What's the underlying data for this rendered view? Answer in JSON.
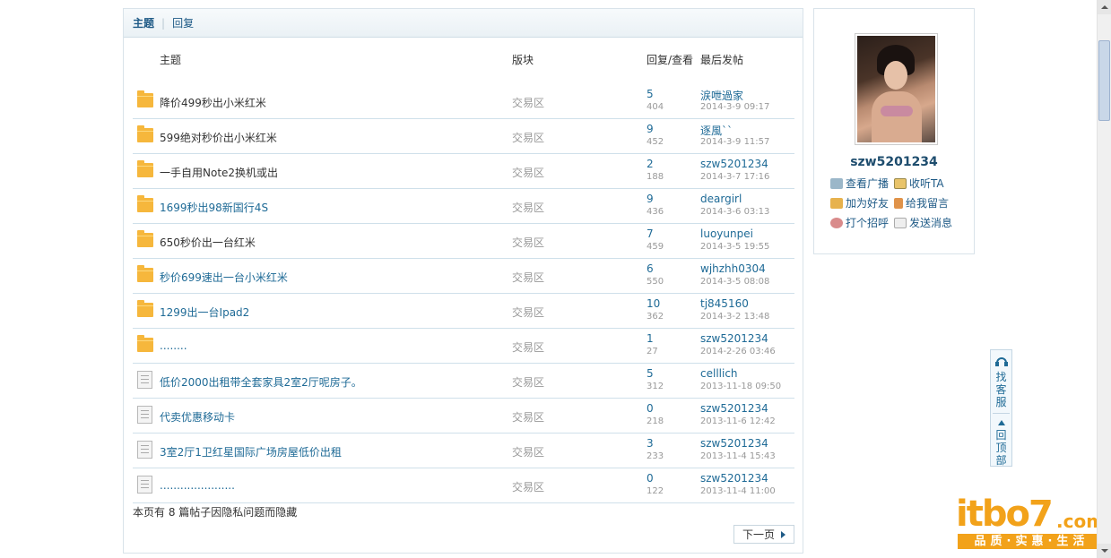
{
  "tabs": {
    "topics": "主题",
    "replies": "回复"
  },
  "table_header": {
    "topic": "主题",
    "forum": "版块",
    "reply_view": "回复/查看",
    "last_post": "最后发帖"
  },
  "rows": [
    {
      "icon": "folder-icon",
      "title": "降价499秒出小米红米",
      "forum": "交易区",
      "replies": "5",
      "views": "404",
      "last_user": "涙呭過家",
      "last_time": "2014-3-9 09:17"
    },
    {
      "icon": "folder-icon",
      "title": "599绝对秒价出小米红米",
      "forum": "交易区",
      "replies": "9",
      "views": "452",
      "last_user": "逐風``",
      "last_time": "2014-3-9 11:57"
    },
    {
      "icon": "folder-icon",
      "title": "一手自用Note2换机或出",
      "forum": "交易区",
      "replies": "2",
      "views": "188",
      "last_user": "szw5201234",
      "last_time": "2014-3-7 17:16"
    },
    {
      "icon": "folder-icon",
      "title": "1699秒出98新国行4S",
      "forum": "交易区",
      "replies": "9",
      "views": "436",
      "last_user": "deargirl",
      "last_time": "2014-3-6 03:13"
    },
    {
      "icon": "folder-icon",
      "title": "650秒价出一台红米",
      "forum": "交易区",
      "replies": "7",
      "views": "459",
      "last_user": "luoyunpei",
      "last_time": "2014-3-5 19:55"
    },
    {
      "icon": "folder-icon",
      "title": "秒价699速出一台小米红米",
      "forum": "交易区",
      "replies": "6",
      "views": "550",
      "last_user": "wjhzhh0304",
      "last_time": "2014-3-5 08:08"
    },
    {
      "icon": "folder-icon",
      "title": "1299出一台Ipad2",
      "forum": "交易区",
      "replies": "10",
      "views": "362",
      "last_user": "tj845160",
      "last_time": "2014-3-2 13:48"
    },
    {
      "icon": "folder-icon",
      "title": "........",
      "forum": "交易区",
      "replies": "1",
      "views": "27",
      "last_user": "szw5201234",
      "last_time": "2014-2-26 03:46"
    },
    {
      "icon": "document-icon",
      "title": "低价2000出租带全套家具2室2厅呢房子。",
      "forum": "交易区",
      "replies": "5",
      "views": "312",
      "last_user": "celllich",
      "last_time": "2013-11-18 09:50"
    },
    {
      "icon": "document-icon",
      "title": "代卖优惠移动卡",
      "forum": "交易区",
      "replies": "0",
      "views": "218",
      "last_user": "szw5201234",
      "last_time": "2013-11-6 12:42"
    },
    {
      "icon": "document-icon",
      "title": "3室2厅1卫红星国际广场房屋低价出租",
      "forum": "交易区",
      "replies": "3",
      "views": "233",
      "last_user": "szw5201234",
      "last_time": "2013-11-4 15:43"
    },
    {
      "icon": "document-icon",
      "title": "......................",
      "forum": "交易区",
      "replies": "0",
      "views": "122",
      "last_user": "szw5201234",
      "last_time": "2013-11-4 11:00"
    }
  ],
  "notice": "本页有 8 篇帖子因隐私问题而隐藏",
  "next_page": "下一页",
  "profile": {
    "username": "szw5201234",
    "links": {
      "broadcast": "查看广播",
      "listen": "收听TA",
      "add_friend": "加为好友",
      "message_board": "给我留言",
      "greet": "打个招呼",
      "send_message": "发送消息"
    }
  },
  "float": {
    "service": "找客服",
    "top": "回顶部"
  },
  "watermark": {
    "logo": "itbo7",
    "com": ".com",
    "slogan": "品质·实惠·生活"
  },
  "colors": {
    "link": "#1e6a96",
    "folder": "#f6b73c",
    "accent": "#f2a21a"
  }
}
